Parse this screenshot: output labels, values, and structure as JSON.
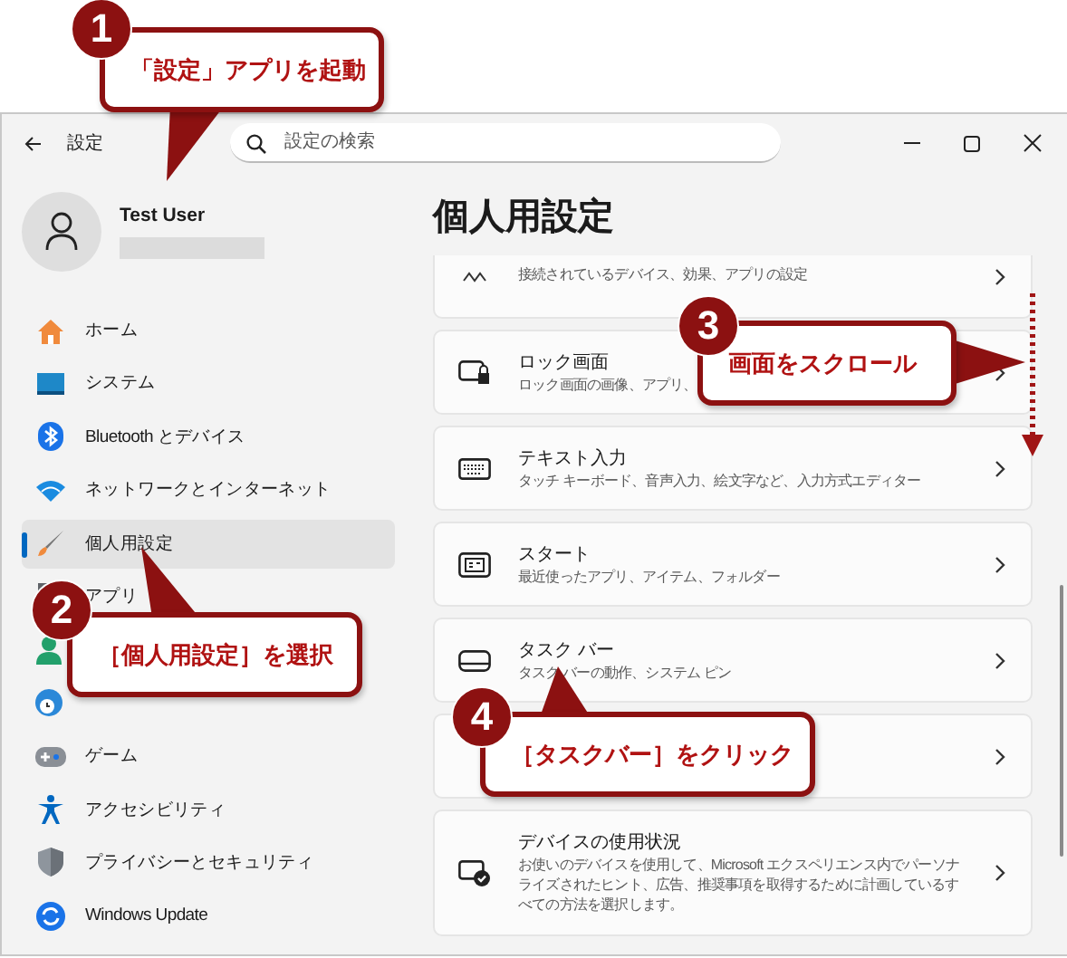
{
  "window": {
    "title": "設定",
    "search": {
      "placeholder": "設定の検索"
    }
  },
  "user": {
    "name": "Test User"
  },
  "sidebar": {
    "items": [
      {
        "kind": "home",
        "label": "ホーム",
        "selected": false
      },
      {
        "kind": "system",
        "label": "システム",
        "selected": false
      },
      {
        "kind": "bluetooth",
        "label": "Bluetooth とデバイス",
        "selected": false
      },
      {
        "kind": "network",
        "label": "ネットワークとインターネット",
        "selected": false
      },
      {
        "kind": "brush",
        "label": "個人用設定",
        "selected": true
      },
      {
        "kind": "apps",
        "label": "アプリ",
        "selected": false
      },
      {
        "kind": "accounts",
        "selected": false
      },
      {
        "kind": "time",
        "selected": false
      },
      {
        "kind": "game",
        "label": "ゲーム",
        "selected": false
      },
      {
        "kind": "accessibility",
        "label": "アクセシビリティ",
        "selected": false
      },
      {
        "kind": "privacy",
        "label": "プライバシーとセキュリティ",
        "selected": false
      },
      {
        "kind": "update",
        "label": "Windows Update",
        "selected": false
      }
    ]
  },
  "page": {
    "title": "個人用設定",
    "cards": [
      {
        "kind": "devices",
        "description": "接続されているデバイス、効果、アプリの設定"
      },
      {
        "kind": "lock",
        "title": "ロック画面",
        "description": "ロック画面の画像、アプリ、"
      },
      {
        "kind": "keyboard",
        "title": "テキスト入力",
        "description": "タッチ キーボード、音声入力、絵文字など、入力方式エディター"
      },
      {
        "kind": "start",
        "title": "スタート",
        "description": "最近使ったアプリ、アイテム、フォルダー"
      },
      {
        "kind": "taskbar",
        "title": "タスク バー",
        "description": "タスク バーの動作、システム ピン"
      },
      {
        "kind": "covered"
      },
      {
        "kind": "usage",
        "title": "デバイスの使用状況",
        "description": "お使いのデバイスを使用して、Microsoft エクスペリエンス内でパーソナライズされたヒント、広告、推奨事項を取得するために計画しているすべての方法を選択します。"
      }
    ]
  },
  "callouts": [
    {
      "number": "1",
      "text": "「設定」アプリを起動"
    },
    {
      "number": "2",
      "text": "［個人用設定］を選択"
    },
    {
      "number": "3",
      "text": "画面をスクロール"
    },
    {
      "number": "4",
      "text": "［タスクバー］をクリック"
    }
  ]
}
